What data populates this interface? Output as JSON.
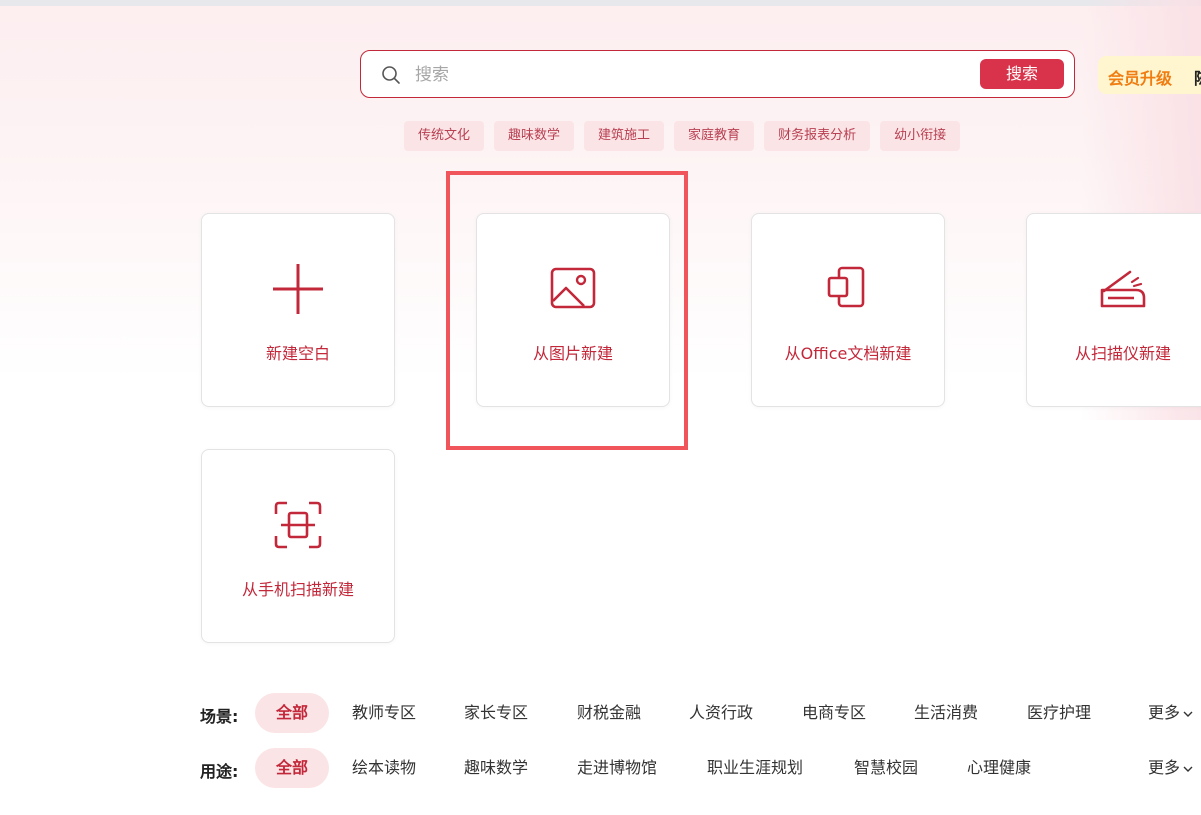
{
  "search": {
    "placeholder": "搜索",
    "button_label": "搜索"
  },
  "vip": {
    "label": "会员升级",
    "extra": "陈"
  },
  "hot_tags": [
    "传统文化",
    "趣味数学",
    "建筑施工",
    "家庭教育",
    "财务报表分析",
    "幼小衔接"
  ],
  "create_cards": [
    {
      "label": "新建空白",
      "icon": "plus-icon"
    },
    {
      "label": "从图片新建",
      "icon": "image-icon"
    },
    {
      "label": "从Office文档新建",
      "icon": "office-doc-icon"
    },
    {
      "label": "从扫描仪新建",
      "icon": "scanner-icon"
    },
    {
      "label": "从手机扫描新建",
      "icon": "phone-scan-icon"
    }
  ],
  "scene_filter": {
    "title": "场景:",
    "items": [
      "全部",
      "教师专区",
      "家长专区",
      "财税金融",
      "人资行政",
      "电商专区",
      "生活消费",
      "医疗护理"
    ],
    "active": "全部",
    "more": "更多"
  },
  "usage_filter": {
    "title": "用途:",
    "items": [
      "全部",
      "绘本读物",
      "趣味数学",
      "走进博物馆",
      "职业生涯规划",
      "智慧校园",
      "心理健康"
    ],
    "active": "全部",
    "more": "更多"
  },
  "colors": {
    "accent": "#c3283a",
    "button": "#d8334a",
    "tag_bg": "#fbe4e6",
    "highlight_border": "#f0555b",
    "vip_text": "#f07d12"
  }
}
